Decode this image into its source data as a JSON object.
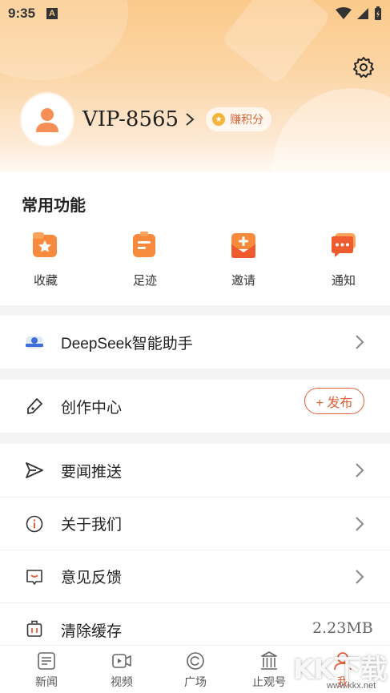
{
  "status_bar": {
    "time": "9:35",
    "notification_icon": "A"
  },
  "profile": {
    "username": "VIP-8565",
    "points_label": "赚积分"
  },
  "features": {
    "title": "常用功能",
    "items": [
      {
        "label": "收藏",
        "icon": "favorite-icon"
      },
      {
        "label": "足迹",
        "icon": "footprint-icon"
      },
      {
        "label": "邀请",
        "icon": "invite-icon"
      },
      {
        "label": "通知",
        "icon": "notification-icon"
      }
    ]
  },
  "menu": {
    "deepseek": "DeepSeek智能助手",
    "creation_center": "创作中心",
    "publish_label": "+ 发布",
    "news_push": "要闻推送",
    "about_us": "关于我们",
    "feedback": "意见反馈",
    "clear_cache": "清除缓存",
    "cache_size": "2.23MB"
  },
  "tabs": [
    {
      "label": "新闻",
      "active": false
    },
    {
      "label": "视频",
      "active": false
    },
    {
      "label": "广场",
      "active": false
    },
    {
      "label": "止观号",
      "active": false
    },
    {
      "label": "我",
      "active": true
    }
  ],
  "watermark": {
    "text": "KK下载",
    "url": "www.kkx.net"
  },
  "colors": {
    "accent": "#e1603a",
    "header_top": "#fbc98a",
    "coin": "#f5b53a"
  }
}
